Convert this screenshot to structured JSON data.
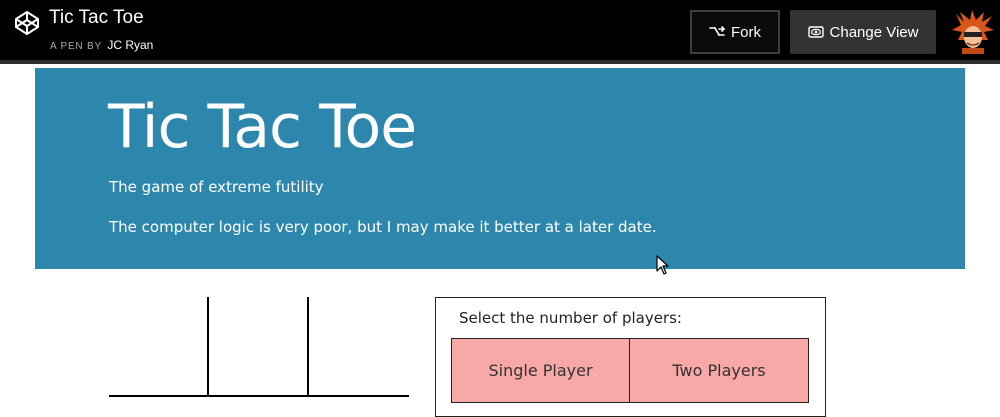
{
  "header": {
    "pen_title": "Tic Tac Toe",
    "byline_prefix": "A PEN BY",
    "author": "JC Ryan",
    "fork_label": "Fork",
    "change_view_label": "Change View",
    "icons": [
      "codepen-logo-icon",
      "fork-icon",
      "eye-icon",
      "avatar"
    ]
  },
  "hero": {
    "title": "Tic Tac Toe",
    "subtitle": "The game of extreme futility",
    "note": "The computer logic is very poor, but I may make it better at a later date."
  },
  "player_select": {
    "prompt": "Select the number of players:",
    "options": [
      "Single Player",
      "Two Players"
    ]
  },
  "colors": {
    "topbar": "#000000",
    "hero": "#2d87ad",
    "option": "#f9a8a8"
  }
}
